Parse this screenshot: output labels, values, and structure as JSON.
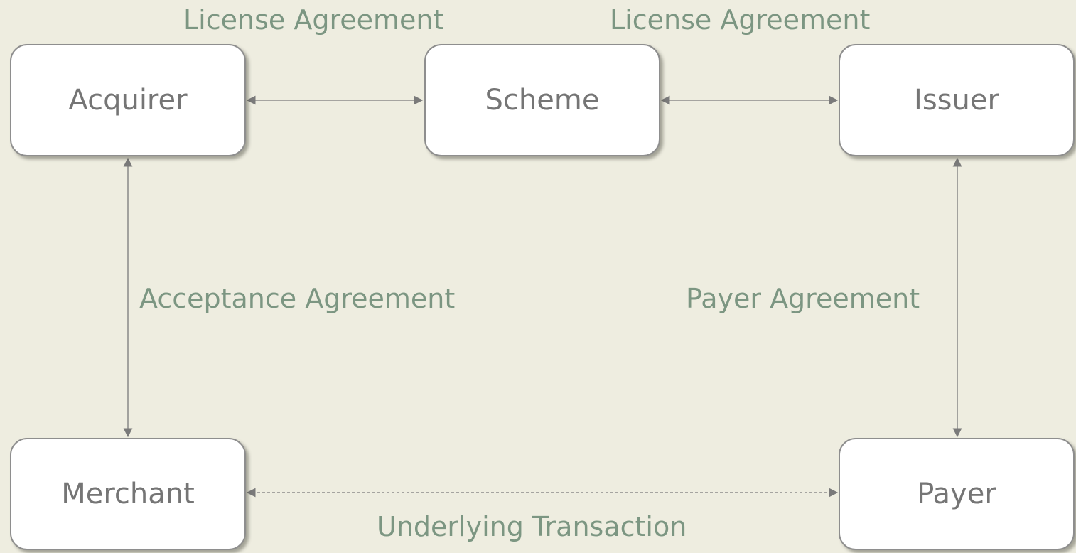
{
  "nodes": {
    "acquirer": "Acquirer",
    "scheme": "Scheme",
    "issuer": "Issuer",
    "merchant": "Merchant",
    "payer": "Payer"
  },
  "edges": {
    "acquirer_scheme": "License Agreement",
    "scheme_issuer": "License Agreement",
    "acquirer_merchant": "Acceptance Agreement",
    "issuer_payer": "Payer Agreement",
    "merchant_payer": "Underlying Transaction"
  },
  "colors": {
    "background": "#eeede0",
    "box_border": "#8e8e8e",
    "box_text": "#757575",
    "edge_label": "#7c9682",
    "connector": "#7a7a7a"
  }
}
